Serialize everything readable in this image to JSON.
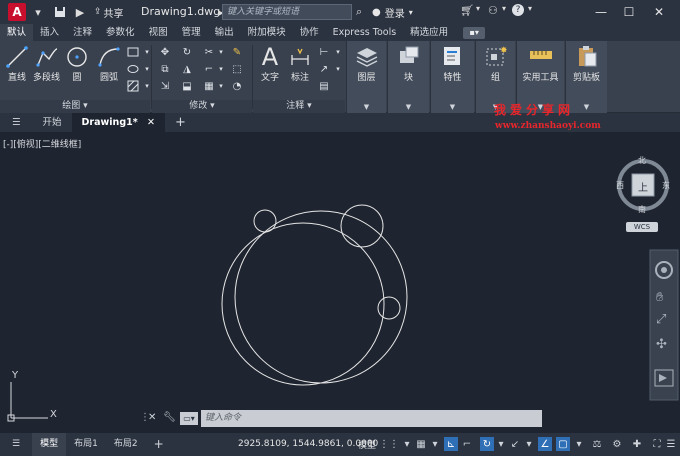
{
  "app": {
    "logo_letter": "A",
    "share_label": "共享",
    "document_title": "Drawing1.dwg",
    "search_placeholder": "键入关键字或短语",
    "login_label": "登录"
  },
  "ribbon_tabs": [
    "默认",
    "插入",
    "注释",
    "参数化",
    "视图",
    "管理",
    "输出",
    "附加模块",
    "协作",
    "Express Tools",
    "精选应用"
  ],
  "ribbon": {
    "draw": {
      "title": "绘图",
      "line": "直线",
      "polyline": "多段线",
      "circle": "圆",
      "arc": "圆弧"
    },
    "modify": {
      "title": "修改"
    },
    "annotation": {
      "title": "注释",
      "text": "文字",
      "dimension": "标注"
    },
    "layers": "图层",
    "block": "块",
    "properties": "特性",
    "group": "组",
    "utilities": "实用工具",
    "clipboard": "剪贴板"
  },
  "doc_tabs": {
    "start": "开始",
    "active": "Drawing1*"
  },
  "watermark": {
    "line1": "我爱分享网",
    "line2": "www.zhanshaoyi.com"
  },
  "viewport": {
    "label": "[-][俯视][二维线框]"
  },
  "viewcube": {
    "north": "北",
    "south": "南",
    "east": "东",
    "west": "西",
    "top": "上",
    "wcs": "WCS"
  },
  "ucs": {
    "x": "X",
    "y": "Y"
  },
  "command": {
    "placeholder": "键入命令"
  },
  "status": {
    "model_tab": "模型",
    "layout1": "布局1",
    "layout2": "布局2",
    "coords": "2925.8109, 1544.9861, 0.0000",
    "space": "模型"
  }
}
